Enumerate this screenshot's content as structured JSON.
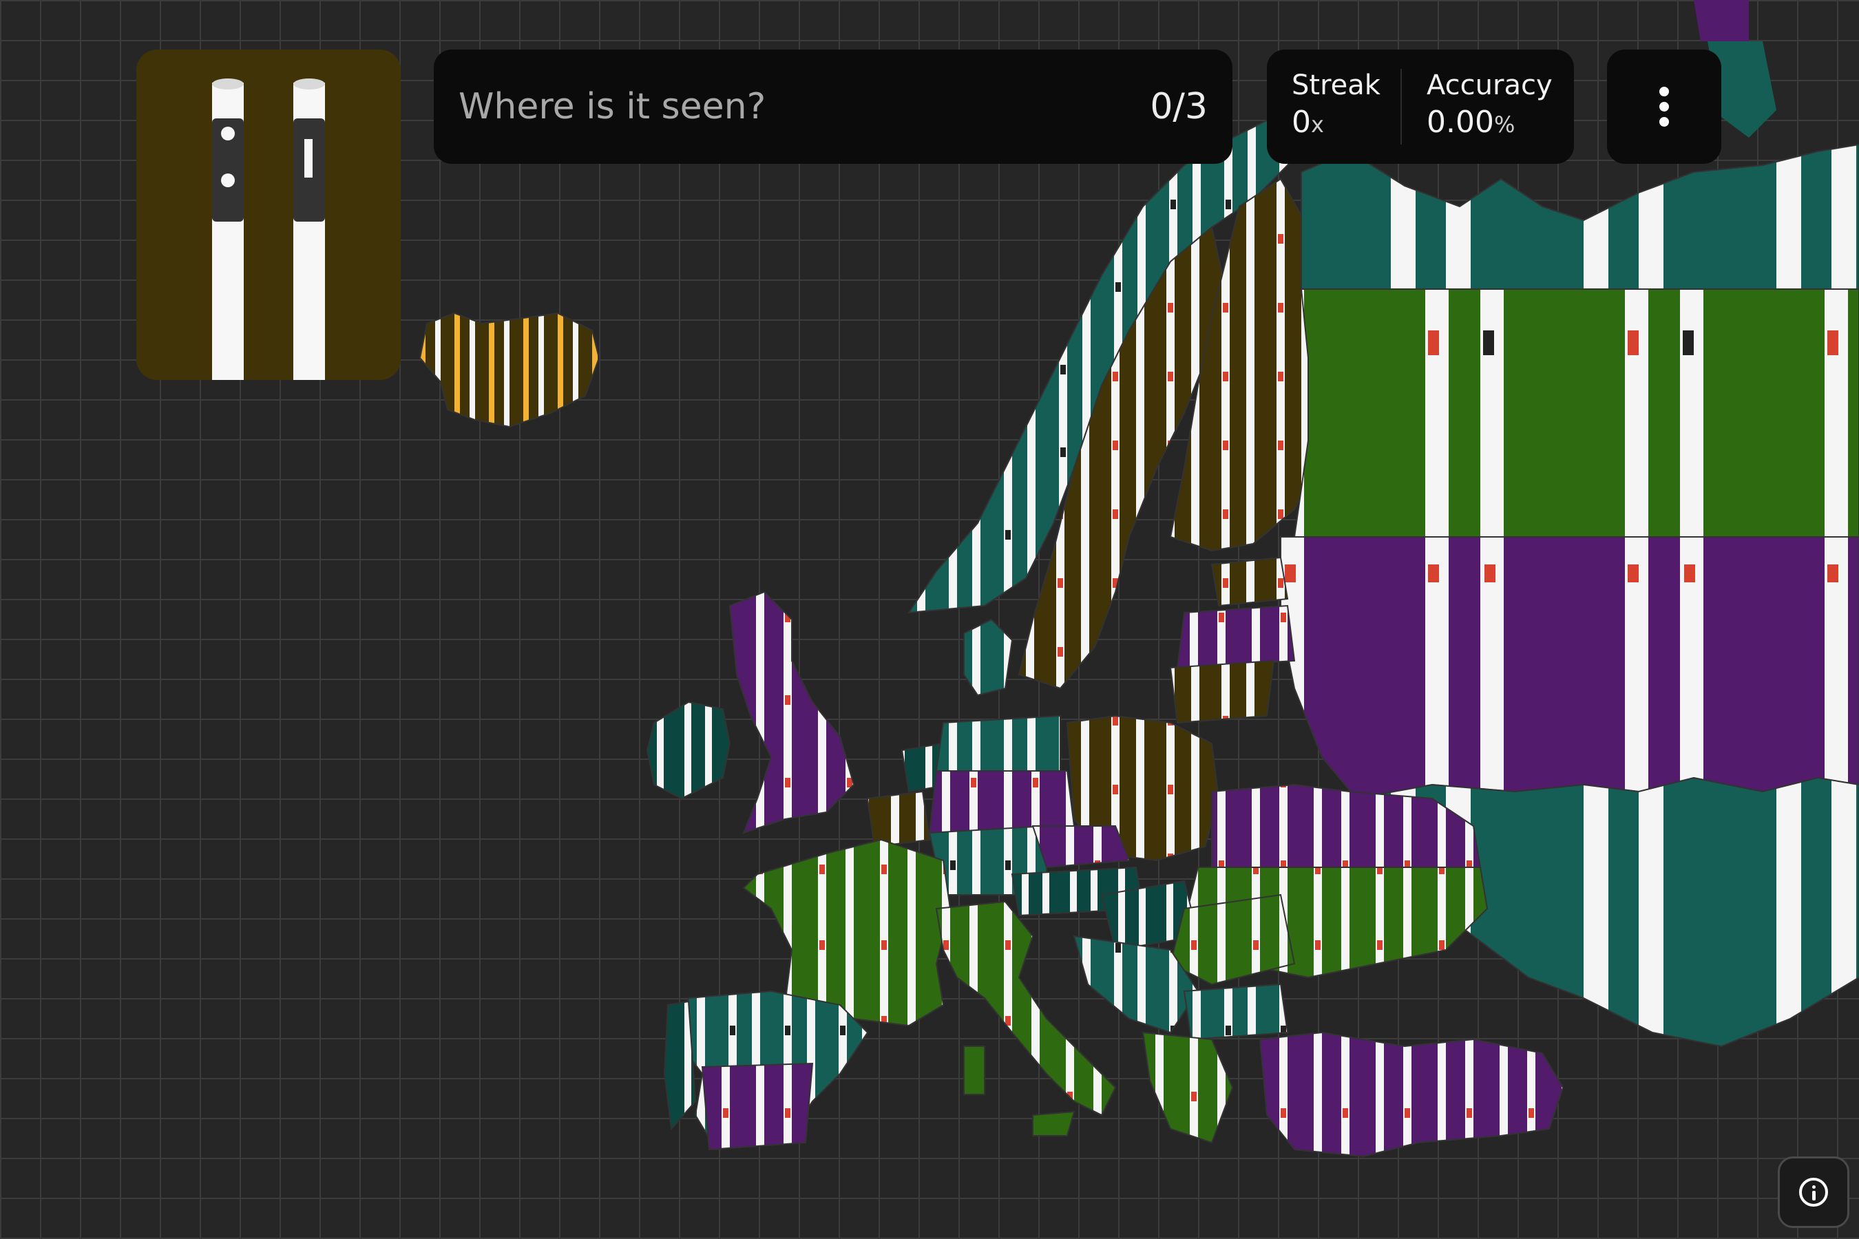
{
  "prompt": {
    "question": "Where is it seen?",
    "progress": "0/3"
  },
  "stats": {
    "streak": {
      "label": "Streak",
      "value": "0",
      "unit": "x"
    },
    "accuracy": {
      "label": "Accuracy",
      "value": "0.00",
      "unit": "%"
    }
  },
  "clue": {
    "description_icon": "bollard-pair-icon",
    "card_color": "#3f3307"
  },
  "menu": {
    "icon": "more-vertical-icon"
  },
  "info": {
    "icon": "info-icon"
  },
  "colors": {
    "background": "#262626",
    "grid": "#3c3c3c",
    "brown": "#3f3307",
    "teal": "#155e55",
    "dark_teal": "#0b4740",
    "green": "#2e6a0f",
    "purple": "#521b6b",
    "amber": "#f2b233",
    "red": "#d7412f"
  }
}
